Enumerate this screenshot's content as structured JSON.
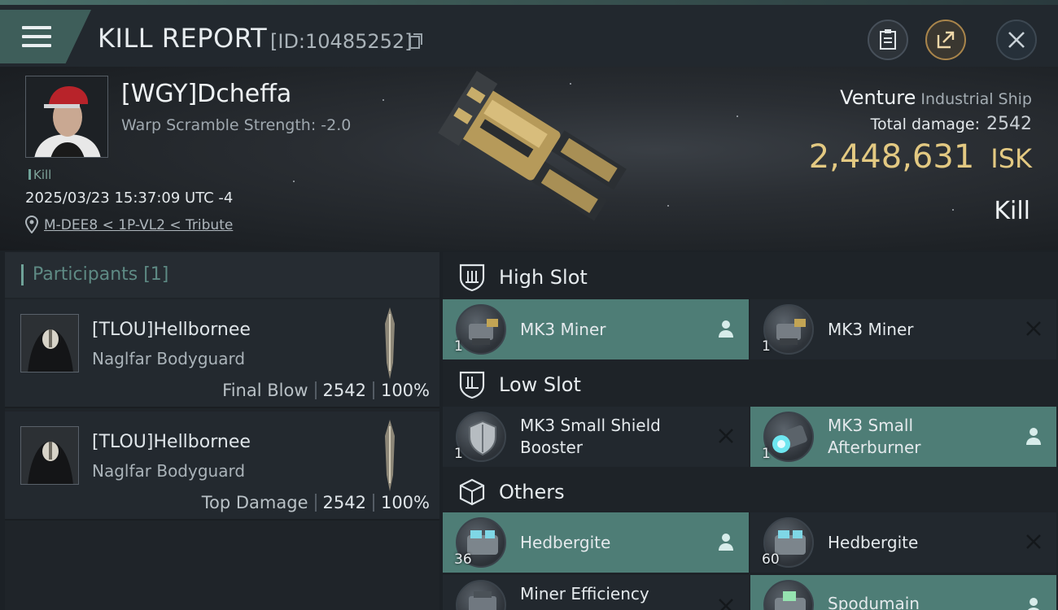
{
  "header": {
    "title": "KILL REPORT",
    "kill_id": "[ID:10485252]"
  },
  "victim": {
    "name": "[WGY]Dcheffa",
    "warp_scramble": "Warp Scramble Strength: -2.0",
    "tag": "Kill",
    "datetime": "2025/03/23 15:37:09 UTC -4",
    "location": "M-DEE8 < 1P-VL2 < Tribute",
    "ship_name": "Venture",
    "ship_class": "Industrial Ship",
    "total_damage_label": "Total damage:",
    "total_damage": "2542",
    "isk_value": "2,448,631",
    "isk_unit": "ISK",
    "result": "Kill"
  },
  "participants": {
    "title": "Participants [1]",
    "rows": [
      {
        "name": "[TLOU]Hellbornee",
        "ship": "Naglfar Bodyguard",
        "label": "Final Blow",
        "damage": "2542",
        "percent": "100%"
      },
      {
        "name": "[TLOU]Hellbornee",
        "ship": "Naglfar Bodyguard",
        "label": "Top Damage",
        "damage": "2542",
        "percent": "100%"
      }
    ]
  },
  "slots": {
    "high": {
      "label": "High Slot",
      "items": [
        {
          "name": "MK3 Miner",
          "qty": "1",
          "status": "person-icon",
          "highlight": true
        },
        {
          "name": "MK3 Miner",
          "qty": "1",
          "status": "x-icon",
          "highlight": false
        }
      ]
    },
    "low": {
      "label": "Low Slot",
      "items": [
        {
          "name_line1": "MK3 Small Shield",
          "name_line2": "Booster",
          "qty": "1",
          "status": "x-icon",
          "highlight": false
        },
        {
          "name_line1": "MK3 Small",
          "name_line2": "Afterburner",
          "qty": "1",
          "status": "person-icon",
          "highlight": true
        }
      ]
    },
    "others": {
      "label": "Others",
      "items": [
        {
          "name": "Hedbergite",
          "qty": "36",
          "status": "person-icon",
          "highlight": true
        },
        {
          "name": "Hedbergite",
          "qty": "60",
          "status": "x-icon",
          "highlight": false
        },
        {
          "name": "Miner Efficiency",
          "qty": "",
          "status": "x-icon",
          "highlight": false
        },
        {
          "name": "Spodumain",
          "qty": "",
          "status": "person-icon",
          "highlight": true
        }
      ]
    }
  }
}
